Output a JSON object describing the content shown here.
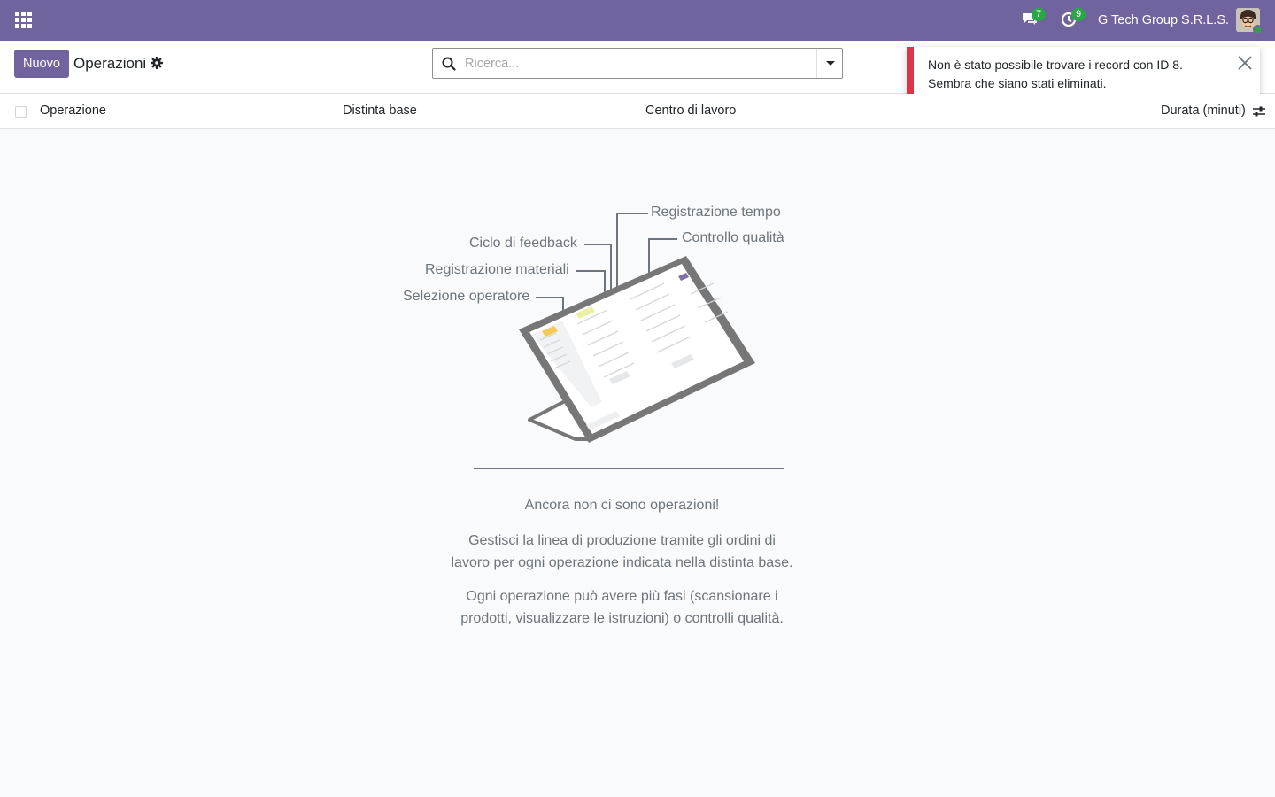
{
  "navbar": {
    "apps_icon": "grid-icon",
    "discuss_icon": "chat-icon",
    "discuss_count": "7",
    "activity_icon": "clock-icon",
    "activity_count": "9",
    "company": "G Tech Group S.R.L.S.",
    "avatar": "user-avatar"
  },
  "control_panel": {
    "new_label": "Nuovo",
    "title": "Operazioni",
    "gear_icon": "gear-icon",
    "search_placeholder": "Ricerca..."
  },
  "notification": {
    "line1": "Non è stato possibile trovare i record con ID 8.",
    "line2": "Sembra che siano stati eliminati.",
    "color": "#dc3545"
  },
  "list": {
    "columns": [
      "Operazione",
      "Distinta base",
      "Centro di lavoro",
      "Durata (minuti)"
    ]
  },
  "empty": {
    "labels": {
      "time": "Registrazione tempo",
      "quality": "Controllo qualità",
      "feedback": "Ciclo di feedback",
      "materials": "Registrazione materiali",
      "operator": "Selezione operatore"
    },
    "title": "Ancora non ci sono operazioni!",
    "p1_line1": "Gestisci la linea di produzione tramite gli ordini di",
    "p1_line2": "lavoro per ogni operazione indicata nella distinta base.",
    "p2_line1": "Ogni operazione può avere più fasi (scansionare i",
    "p2_line2": "prodotti, visualizzare le istruzioni) o controlli qualità."
  },
  "colors": {
    "brand": "#71639e",
    "badge": "#28a745",
    "muted": "#6c757d"
  }
}
